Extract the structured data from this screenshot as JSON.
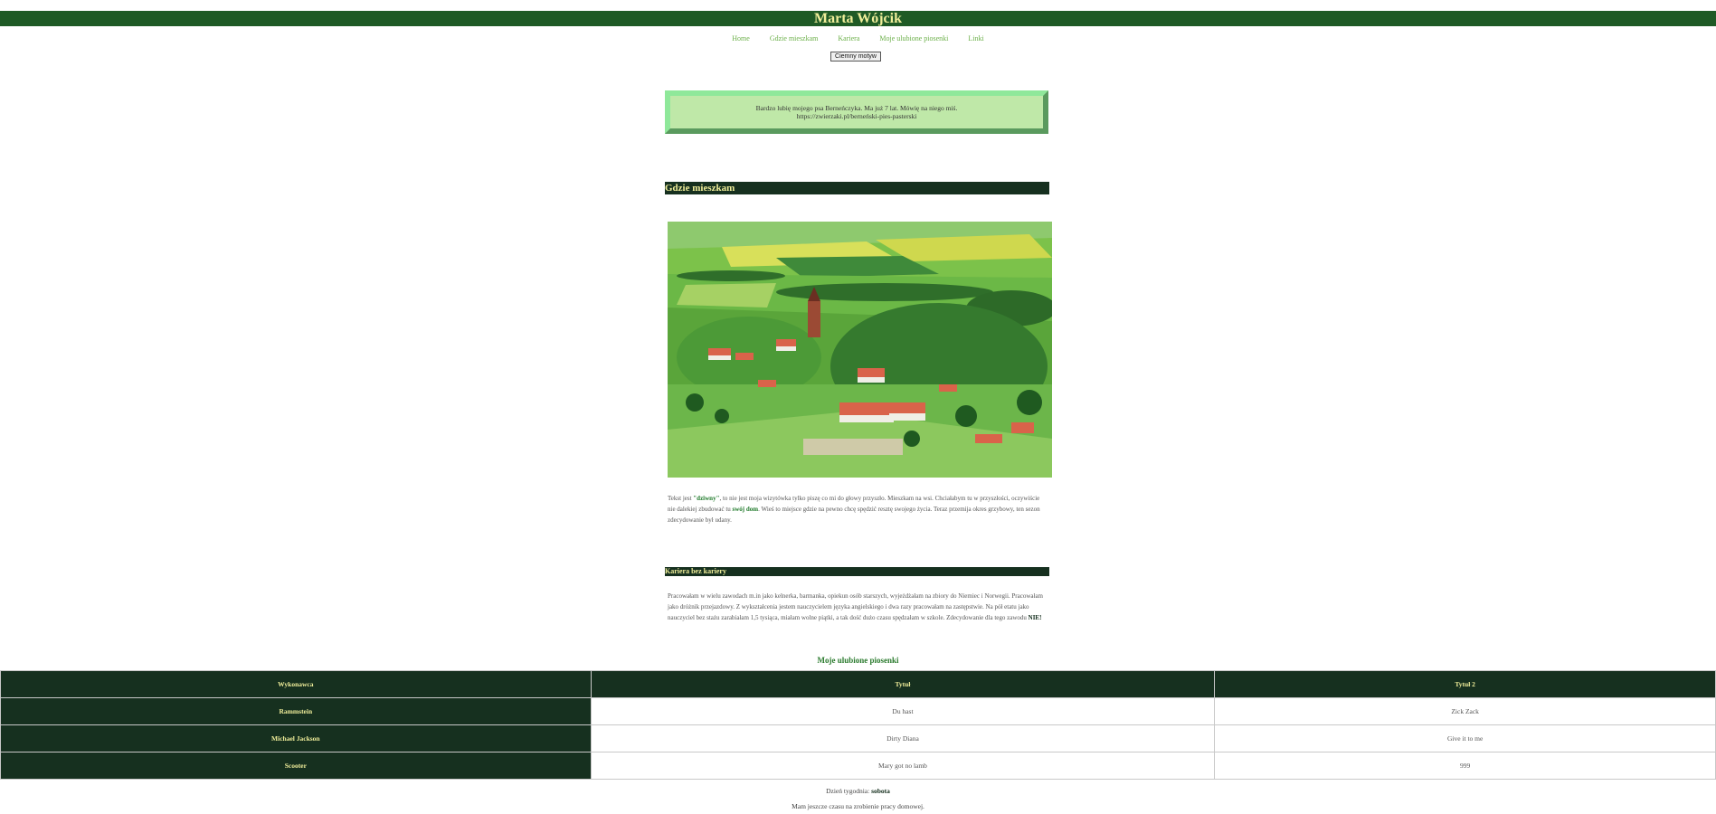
{
  "header": {
    "title": "Marta Wójcik"
  },
  "nav": {
    "items": [
      "Home",
      "Gdzie mieszkam",
      "Kariera",
      "Moje ulubione piosenki",
      "Linki"
    ]
  },
  "theme_button": {
    "label": "Ciemny motyw"
  },
  "quote": {
    "line1": "Bardzo lubię mojego psa Berneńczyka. Ma już 7 lat. Mówię na niego miś.",
    "line2": "https://zwierzaki.pl/berneński-pies-pasterski"
  },
  "section_home": {
    "heading": "Gdzie mieszkam",
    "text_a": "Tekst jest ",
    "em1": "\"dziwny\"",
    "text_b": ", to nie jest moja wizytówka tylko piszę co mi do głowy przyszło. Mieszkam na wsi. Chciałabym tu w przyszłości, oczywiście nie dalekiej zbudować tu ",
    "em2": "swój dom",
    "text_c": ". Wieś to miejsce gdzie na pewno chcę spędzić resztę swojego życia. Teraz przemija okres grzybowy, ten sezon zdecydowanie był udany."
  },
  "section_career": {
    "heading": "Kariera bez kariery",
    "text_a": "Pracowałam w wielu zawodach m.in jako kelnerka, barmanka, opiekun osób starszych, wyjeżdżałam na zbiory do Niemiec i Norwegii. Pracowałam jako dróżnik przejazdowy. Z wykształcenia jestem nauczycielem języka angielskiego i dwa razy pracowałam na zastępstwie. Na pół etatu jako nauczyciel bez stażu zarabiałam 1,5 tysiąca, miałam wolne piątki, a tak dość dużo czasu spędzałam w szkole. Zdecydowanie dla tego zawodu ",
    "em": "NIE!"
  },
  "songs": {
    "title": "Moje ulubione piosenki",
    "headers": [
      "Wykonawca",
      "Tytuł",
      "Tytuł 2"
    ],
    "rows": [
      [
        "Rammstein",
        "Du hast",
        "Zick Zack"
      ],
      [
        "Michael Jackson",
        "Dirty Diana",
        "Give it to me"
      ],
      [
        "Scooter",
        "Mary got no lamb",
        "999"
      ]
    ]
  },
  "footer": {
    "day_label": "Dzień tygodnia: ",
    "day_value": "sobota",
    "note": "Mam jeszcze czasu na zrobienie pracy domowej."
  },
  "colors": {
    "header_bg": "#1f5a25",
    "dark_bar": "#16301f",
    "title_yellow": "#f0ee9a",
    "nav_green": "#6cb04a",
    "quote_bg": "#bfe8a8"
  }
}
